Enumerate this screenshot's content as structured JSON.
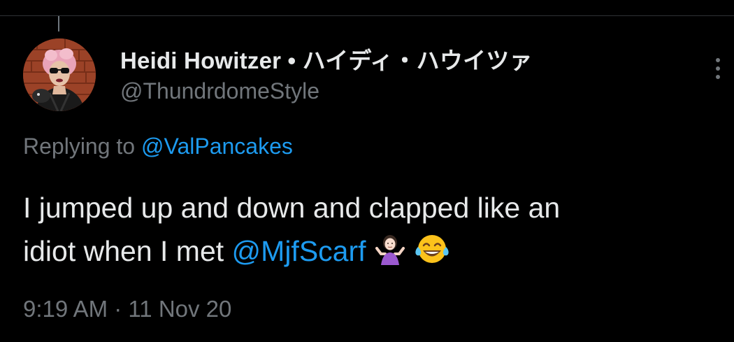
{
  "tweet": {
    "author": {
      "display_name": "Heidi Howitzer • ハイディ・ハウイツァ",
      "handle": "@ThundrdomeStyle"
    },
    "reply": {
      "prefix": "Replying to",
      "mention": "@ValPancakes"
    },
    "text": {
      "line1": "I jumped up and down and clapped like an",
      "line2_prefix": "idiot when I met",
      "mention": "@MjfScarf",
      "emojis": [
        "person-shrugging-emoji",
        "face-with-tears-of-joy-emoji"
      ]
    },
    "timestamp": "9:19 AM · 11 Nov 20",
    "icons": {
      "more": "more-vertical-icon"
    },
    "colors": {
      "background": "#000000",
      "primary_text": "#e7e9ea",
      "secondary_text": "#71767b",
      "link": "#1d9bf0"
    }
  }
}
